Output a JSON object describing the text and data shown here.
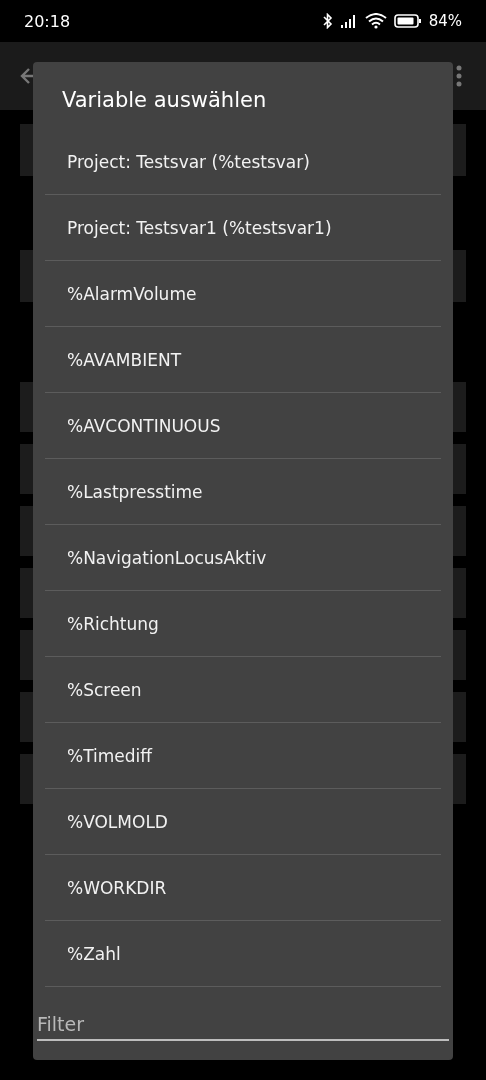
{
  "status_bar": {
    "time": "20:18",
    "battery": "84%"
  },
  "dialog": {
    "title": "Variable auswählen",
    "items": [
      "Project: Testsvar (%testsvar)",
      "Project: Testsvar1 (%testsvar1)",
      "%AlarmVolume",
      "%AVAMBIENT",
      "%AVCONTINUOUS",
      "%Lastpresstime",
      "%NavigationLocusAktiv",
      "%Richtung",
      "%Screen",
      "%Timediff",
      "%VOLMOLD",
      "%WORKDIR",
      "%Zahl"
    ],
    "filter": {
      "placeholder": "Filter"
    }
  }
}
